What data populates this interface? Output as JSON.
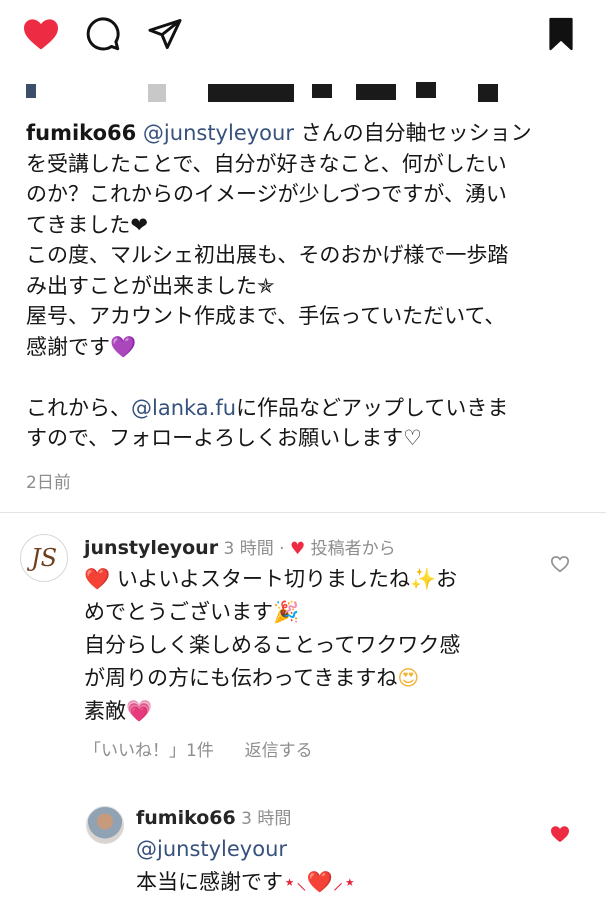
{
  "actions": {
    "like": "heart-filled-icon",
    "comment": "comment-bubble-icon",
    "share": "paper-plane-icon",
    "save": "bookmark-filled-icon"
  },
  "caption": {
    "user": "fumiko66",
    "l1_mention": "@junstyleyour",
    "l1_rest": " さんの自分軸セッション",
    "l2": "を受講したことで、自分が好きなこと、何がしたい",
    "l3": "のか？これからのイメージが少しづつですが、湧い",
    "l4": "てきました",
    "l4_emoji": "❤",
    "l5": "この度、マルシェ初出展も、そのおかげ様で一歩踏",
    "l6": "み出すことが出来ました",
    "l6_emoji": "✯",
    "l7": "屋号、アカウント作成まで、手伝っていただいて、",
    "l8": "感謝です",
    "l8_emoji": "💜",
    "l9_pre": "これから、",
    "l9_mention": "@lanka.fu",
    "l9_rest": "に作品などアップしていきま",
    "l10": "すので、フォローよろしくお願いします♡"
  },
  "time_ago": "2日前",
  "comment1": {
    "avatar_text": "JS",
    "username": "junstyleyour",
    "time": "3 時間",
    "sep": "·",
    "heart": "♥",
    "by_author": "投稿者から",
    "l1_emoji": "❤️",
    "l1": "いよいよスタート切りましたね",
    "l1_emoji2": "✨",
    "l1_end": "お",
    "l2": "めでとうございます",
    "l2_emoji": "🎉",
    "l3": "自分らしく楽しめることってワクワク感",
    "l4": "が周りの方にも伝わってきますね",
    "l4_emoji": "😍",
    "l5": "素敵",
    "l5_emoji": "💗",
    "likes": "「いいね！」1件",
    "reply": "返信する"
  },
  "comment2": {
    "username": "fumiko66",
    "time": "3 時間",
    "mention": "@junstyleyour",
    "text": "本当に感謝です",
    "text_emoji": "⋆⸜❤️⸝⋆"
  },
  "colors": {
    "like_red": "#ed2b42",
    "mention_blue": "#37517e",
    "muted_gray": "#8e8e8e"
  }
}
